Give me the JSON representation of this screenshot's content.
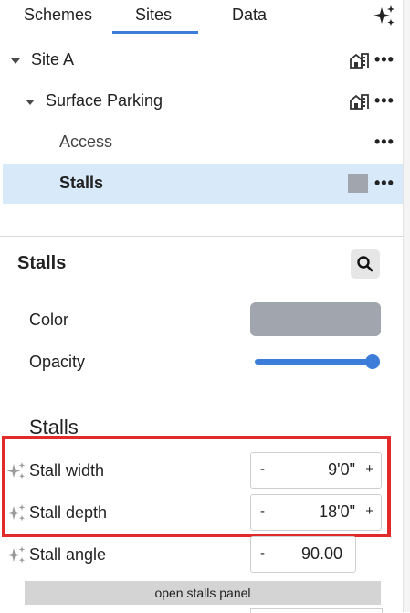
{
  "tabs": [
    {
      "label": "Schemes"
    },
    {
      "label": "Sites"
    },
    {
      "label": "Data"
    }
  ],
  "active_tab": "Sites",
  "tree": {
    "site": {
      "label": "Site A"
    },
    "parking": {
      "label": "Surface Parking"
    },
    "access": {
      "label": "Access"
    },
    "stalls": {
      "label": "Stalls"
    },
    "more_label": "•••"
  },
  "properties": {
    "title": "Stalls",
    "color_label": "Color",
    "color_value": "#a1a5ae",
    "opacity_label": "Opacity",
    "opacity_value": 1.0,
    "section_heading": "Stalls",
    "stall_width": {
      "label": "Stall width",
      "minus": "-",
      "value": "9'0\"",
      "plus": "+"
    },
    "stall_depth": {
      "label": "Stall depth",
      "minus": "-",
      "value": "18'0\"",
      "plus": "+"
    },
    "stall_angle": {
      "label": "Stall angle",
      "minus": "-",
      "value": "90.00"
    },
    "open_panel_label": "open stalls panel"
  },
  "colors": {
    "accent": "#3b7dd8",
    "selected_row": "#d8e9f9",
    "highlight": "#e32a2a"
  },
  "icons": {
    "top_right": "sparkle-icon",
    "building": "building-icon",
    "search": "search-icon",
    "ai": "sparkle-icon"
  }
}
